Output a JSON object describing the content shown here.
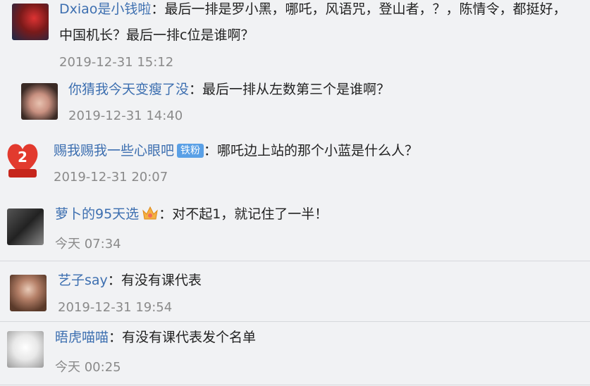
{
  "comments": [
    {
      "user": "Dxiao是小钱啦",
      "text1": "最后一排是罗小黑，哪吒，风语咒，登山者，？，陈情令，都挺好，",
      "text2": "中国机长？最后一排c位是谁啊？",
      "time": "2019-12-31 15:12"
    },
    {
      "user": "你猜我今天变瘦了没",
      "text": "最后一排从左数第三个是谁啊？",
      "time": "2019-12-31 14:40"
    },
    {
      "user": "赐我赐我一些心眼吧",
      "badge": "铁粉",
      "text": "哪吒边上站的那个小蓝是什么人？",
      "time": "2019-12-31 20:07",
      "avatar_text": "2"
    },
    {
      "user": "萝卜的95天选",
      "text": "对不起1，就记住了一半！",
      "time": "今天 07:34"
    },
    {
      "user": "艺子say",
      "text": "有没有课代表",
      "time": "2019-12-31 19:54"
    },
    {
      "user": "晤虎喵喵",
      "text": "有没有课代表发个名单",
      "time": "今天 00:25"
    }
  ],
  "colon": "："
}
